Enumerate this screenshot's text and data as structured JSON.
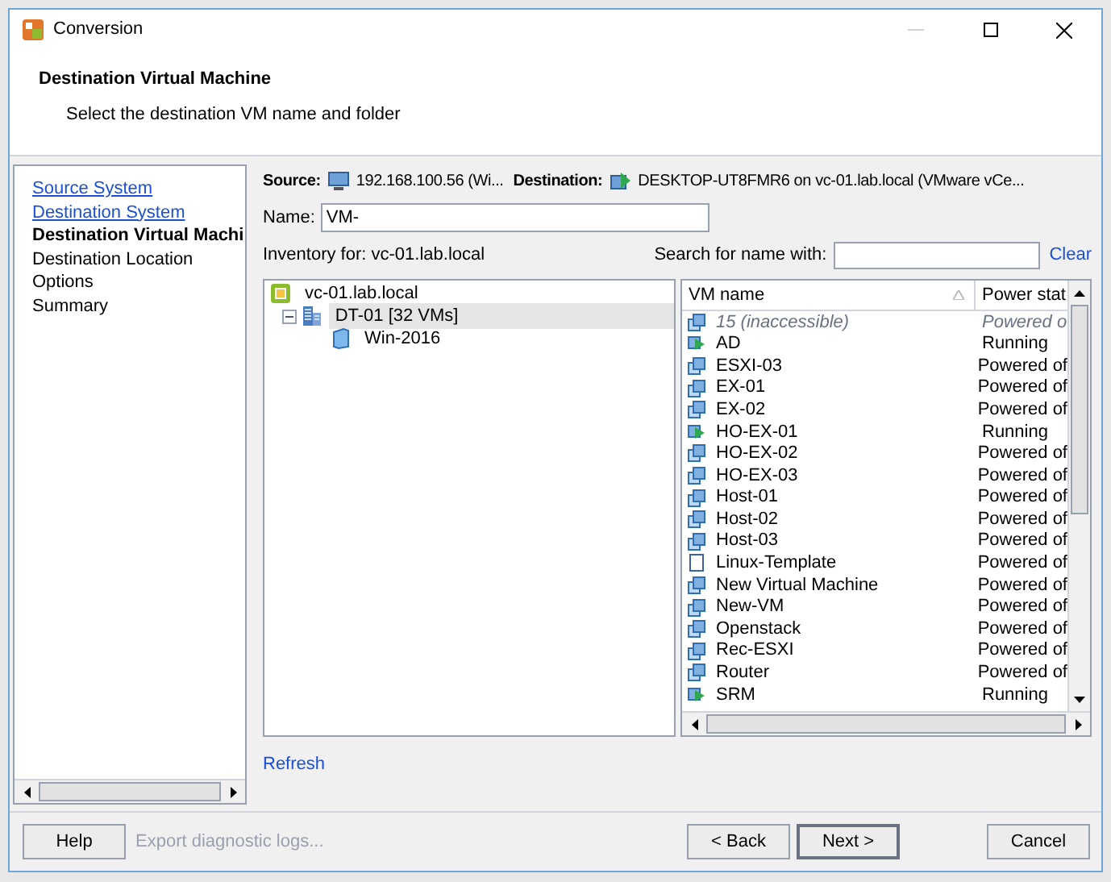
{
  "window": {
    "title": "Conversion"
  },
  "header": {
    "title": "Destination Virtual Machine",
    "subtitle": "Select the destination VM name and folder"
  },
  "steps": [
    {
      "label": "Source System",
      "kind": "done"
    },
    {
      "label": "Destination System",
      "kind": "done"
    },
    {
      "label": "Destination Virtual Machi",
      "kind": "current"
    },
    {
      "label": "Destination Location",
      "kind": "pending"
    },
    {
      "label": "Options",
      "kind": "pending"
    },
    {
      "label": "Summary",
      "kind": "pending"
    }
  ],
  "source": {
    "label": "Source:",
    "value": "192.168.100.56 (Wi..."
  },
  "destination": {
    "label": "Destination:",
    "value": "DESKTOP-UT8FMR6 on vc-01.lab.local (VMware vCe..."
  },
  "name_field": {
    "label": "Name:",
    "value": "VM-"
  },
  "inventory": {
    "label": "Inventory for:",
    "value": "vc-01.lab.local"
  },
  "search": {
    "label": "Search for name with:",
    "clear": "Clear"
  },
  "tree": [
    {
      "label": "vc-01.lab.local",
      "kind": "vcenter",
      "selected": false,
      "children": [
        {
          "label": "DT-01 [32 VMs]",
          "kind": "datacenter",
          "selected": true,
          "expanded": true,
          "children": [
            {
              "label": "Win-2016",
              "kind": "folder",
              "selected": false
            }
          ]
        }
      ]
    }
  ],
  "vm_table": {
    "columns": [
      "VM name",
      "Power stat"
    ],
    "rows": [
      {
        "name": "15 (inaccessible)",
        "state": "Powered o",
        "kind": "inaccessible"
      },
      {
        "name": "AD",
        "state": "Running",
        "kind": "running"
      },
      {
        "name": "ESXI-03",
        "state": "Powered of",
        "kind": "vm"
      },
      {
        "name": "EX-01",
        "state": "Powered of",
        "kind": "vm"
      },
      {
        "name": "EX-02",
        "state": "Powered of",
        "kind": "vm"
      },
      {
        "name": "HO-EX-01",
        "state": "Running",
        "kind": "running"
      },
      {
        "name": "HO-EX-02",
        "state": "Powered of",
        "kind": "vm"
      },
      {
        "name": "HO-EX-03",
        "state": "Powered of",
        "kind": "vm"
      },
      {
        "name": "Host-01",
        "state": "Powered of",
        "kind": "vm"
      },
      {
        "name": "Host-02",
        "state": "Powered of",
        "kind": "vm"
      },
      {
        "name": "Host-03",
        "state": "Powered of",
        "kind": "vm"
      },
      {
        "name": "Linux-Template",
        "state": "Powered of",
        "kind": "template"
      },
      {
        "name": "New Virtual Machine",
        "state": "Powered of",
        "kind": "vm"
      },
      {
        "name": "New-VM",
        "state": "Powered of",
        "kind": "vm"
      },
      {
        "name": "Openstack",
        "state": "Powered of",
        "kind": "vm"
      },
      {
        "name": "Rec-ESXI",
        "state": "Powered of",
        "kind": "vm"
      },
      {
        "name": "Router",
        "state": "Powered of",
        "kind": "vm"
      },
      {
        "name": "SRM",
        "state": "Running",
        "kind": "running"
      }
    ]
  },
  "refresh": "Refresh",
  "footer": {
    "help": "Help",
    "export": "Export diagnostic logs...",
    "back": "< Back",
    "next": "Next >",
    "cancel": "Cancel"
  }
}
